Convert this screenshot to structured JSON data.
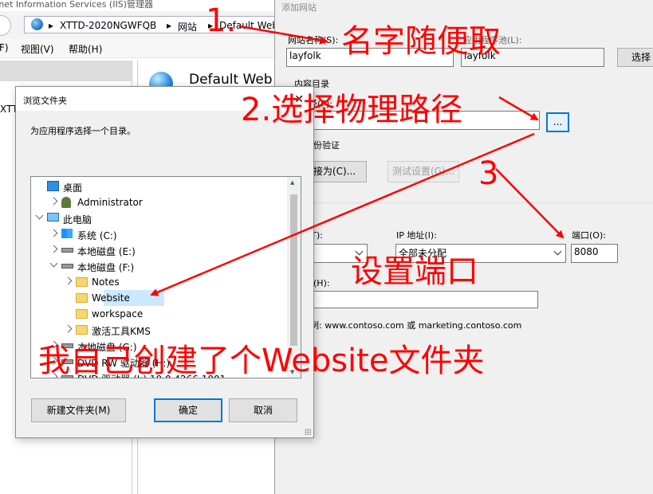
{
  "iis": {
    "window_title": "rnet Information Services (IIS)管理器",
    "breadcrumb": [
      "XTTD-2020NGWFQB",
      "网站",
      "Default Web"
    ],
    "menu": [
      "F)",
      "视图(V)",
      "帮助(H)"
    ],
    "tree_fragments": [
      "XTT"
    ],
    "detail_title": "Default Web"
  },
  "add_site": {
    "window_title": "添加网站",
    "site_name_label": "网站名称(S):",
    "site_name_value": "layfolk",
    "app_pool_label": "应用程序池(L):",
    "app_pool_value": "layfolk",
    "select_button": "选择",
    "content_dir_label": "内容目录",
    "physical_path_label": "理路径(P):",
    "physical_path_value": "",
    "browse_button": "...",
    "passthrough_label": "递身份验证",
    "connect_as_button": "连接为(C)...",
    "test_settings_button": "测试设置(G)...",
    "binding_type_label": "型(T):",
    "binding_type_value": "tp",
    "ip_label": "IP 地址(I):",
    "ip_value": "全部未分配",
    "port_label": "端口(O):",
    "port_value": "8080",
    "hostname_label": "机名(H):",
    "hostname_value": "",
    "example_text": "例: www.contoso.com 或 marketing.contoso.com"
  },
  "browse_dialog": {
    "title": "浏览文件夹",
    "close_glyph": "✕",
    "prompt": "为应用程序选择一个目录。",
    "tree": [
      {
        "label": "桌面",
        "icon": "desktop-icon",
        "level": 0,
        "expander": "none"
      },
      {
        "label": "Administrator",
        "icon": "user-folder-icon",
        "level": 1,
        "expander": "closed"
      },
      {
        "label": "此电脑",
        "icon": "computer-icon",
        "level": 0,
        "expander": "open"
      },
      {
        "label": "系统 (C:)",
        "icon": "windows-drive-icon",
        "level": 1,
        "expander": "closed"
      },
      {
        "label": "本地磁盘 (E:)",
        "icon": "drive-icon",
        "level": 1,
        "expander": "closed"
      },
      {
        "label": "本地磁盘 (F:)",
        "icon": "drive-icon",
        "level": 1,
        "expander": "open"
      },
      {
        "label": "Notes",
        "icon": "folder-icon",
        "level": 2,
        "expander": "closed"
      },
      {
        "label": "Website",
        "icon": "folder-icon",
        "level": 2,
        "expander": "none",
        "selected": true
      },
      {
        "label": "workspace",
        "icon": "folder-icon",
        "level": 2,
        "expander": "none"
      },
      {
        "label": "激活工具KMS",
        "icon": "folder-icon",
        "level": 2,
        "expander": "closed"
      },
      {
        "label": "本地磁盘 (G:)",
        "icon": "drive-icon",
        "level": 1,
        "expander": "closed"
      },
      {
        "label": "DVD RW 驱动器 (H:)",
        "icon": "dvd-icon",
        "level": 1,
        "expander": "closed"
      },
      {
        "label": "DVD 驱动器 (I:) 10.0.4266.1001",
        "icon": "dvd-icon",
        "level": 1,
        "expander": "closed"
      }
    ],
    "new_folder_button": "新建文件夹(M)",
    "ok_button": "确定",
    "cancel_button": "取消"
  },
  "annotations": {
    "step1_number": "1.",
    "step1_text": "名字随便取",
    "step2_text": "2.选择物理路径",
    "step3_number": "3",
    "step3_text": "设置端口",
    "note_text": "我自己创建了个Website文件夹"
  },
  "colors": {
    "annotation": "#ff0000",
    "selection": "#cce8ff",
    "accent": "#0078d7"
  }
}
